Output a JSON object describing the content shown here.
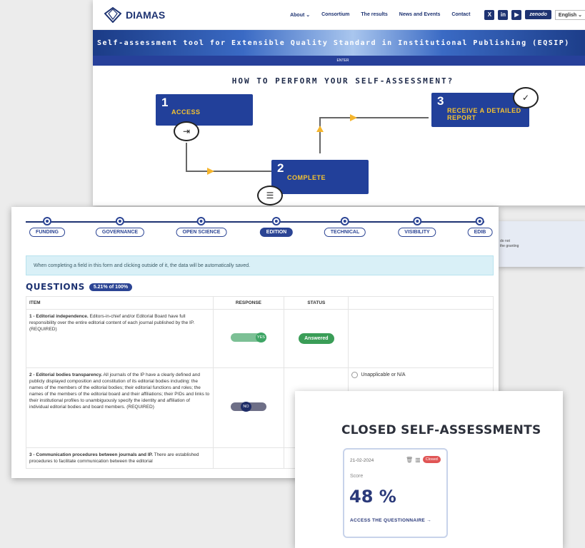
{
  "site": {
    "logo": "DIAMAS",
    "nav": [
      "About ⌄",
      "Consortium",
      "The results",
      "News and Events",
      "Contact"
    ],
    "social": [
      "X",
      "in",
      "▶"
    ],
    "zenodo": "zenodo",
    "language": "English ⌄",
    "banner": "Self-assessment tool for Extensible Quality Standard in Institutional Publishing (EQSIP)",
    "enter": "ENTER",
    "howto": "HOW TO PERFORM YOUR SELF-ASSESSMENT?",
    "steps": [
      {
        "num": "1",
        "label": "ACCESS"
      },
      {
        "num": "2",
        "label": "COMPLETE"
      },
      {
        "num": "3",
        "label": "RECEIVE A DETAILED REPORT"
      }
    ]
  },
  "questionnaire": {
    "stages": [
      "FUNDING",
      "GOVERNANCE",
      "OPEN SCIENCE",
      "EDITION",
      "TECHNICAL",
      "VISIBILITY",
      "EDIB"
    ],
    "active_stage": "EDITION",
    "autosave": "When completing a field in this form and clicking outside of it, the data will be automatically saved.",
    "title": "QUESTIONS",
    "progress": "5.21% of 100%",
    "columns": [
      "ITEM",
      "RESPONSE",
      "STATUS",
      ""
    ],
    "rows": [
      {
        "bold": "1 - Editorial independence.",
        "text": " Editors-in-chief and/or Editorial Board have full responsibility over the entire editorial content of each journal published by the IP. (REQUIRED)",
        "response": "YES",
        "status": "Answered"
      },
      {
        "bold": "2 - Editorial bodies transparency.",
        "text": " All journals of the IP have a clearly defined and publicly displayed composition and constitution of its editorial bodies including: the names of the members of the editorial bodies; their editorial functions and roles; the names of the members of the editorial board and their affiliations; their PIDs and links to their institutional profiles to unambiguously specify the identity and affiliation of individual editorial bodies and board members. (REQUIRED)",
        "response": "NO",
        "option": "Unapplicable or N/A"
      },
      {
        "bold": "3 - Communication procedures between journals and IP.",
        "text": " There are established procedures to facilitate communication between the editorial"
      }
    ]
  },
  "sidepanel": {
    "line1": "do not",
    "line2": "the granting"
  },
  "closed": {
    "title": "CLOSED SELF-ASSESSMENTS",
    "card": {
      "date": "21-02-2024",
      "badge": "Closed",
      "score_label": "Score",
      "score": "48 %",
      "access": "ACCESS THE QUESTIONNAIRE →"
    }
  }
}
